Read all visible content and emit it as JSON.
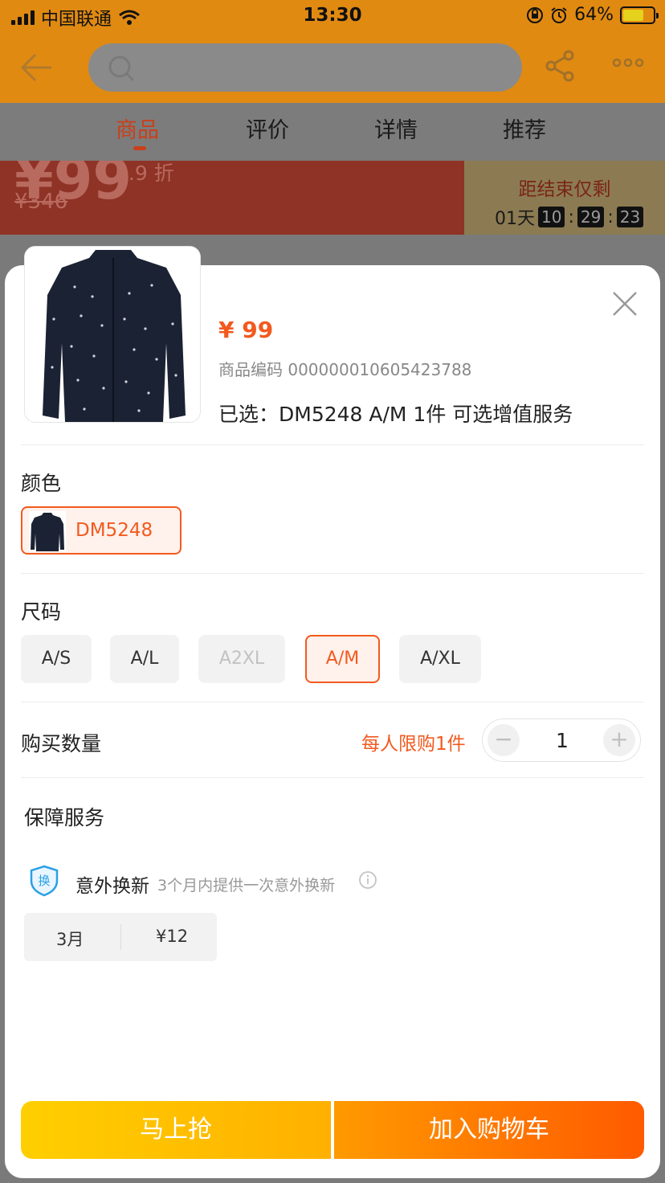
{
  "status_bar": {
    "carrier": "中国联通",
    "time": "13:30",
    "battery": "64%"
  },
  "nav": {
    "tabs": [
      {
        "label": "商品",
        "active": true
      },
      {
        "label": "评价",
        "active": false
      },
      {
        "label": "详情",
        "active": false
      },
      {
        "label": "推荐",
        "active": false
      }
    ]
  },
  "promo": {
    "price_partial": "¥99",
    "discount": "2.9 折",
    "original_price": "¥346",
    "countdown_label": "距结束仅剩",
    "days": "01天",
    "hours": "10",
    "minutes": "29",
    "seconds": "23"
  },
  "sheet": {
    "price": "¥ 99",
    "product_code": "商品编码 000000010605423788",
    "selected_summary": "已选：DM5248 A/M  1件  可选增值服务",
    "color_title": "颜色",
    "color_options": [
      {
        "label": "DM5248",
        "selected": true
      }
    ],
    "size_title": "尺码",
    "sizes": [
      {
        "label": "A/S",
        "state": "normal"
      },
      {
        "label": "A/L",
        "state": "normal"
      },
      {
        "label": "A2XL",
        "state": "disabled"
      },
      {
        "label": "A/M",
        "state": "selected"
      },
      {
        "label": "A/XL",
        "state": "normal"
      }
    ],
    "quantity_title": "购买数量",
    "quantity_limit": "每人限购1件",
    "quantity_value": "1",
    "service_title": "保障服务",
    "service": {
      "icon_text": "换",
      "name": "意外换新",
      "description": "3个月内提供一次意外换新",
      "plan_term": "3月",
      "plan_price": "¥12"
    },
    "buy_now": "马上抢",
    "add_to_cart": "加入购物车"
  },
  "colors": {
    "accent": "#f25a1f",
    "nav_bg": "#e08a12",
    "buy_now_gradient": [
      "#ffcf00",
      "#ffb000"
    ],
    "cart_gradient": [
      "#ff9a00",
      "#ff5a00"
    ]
  },
  "icons": [
    "back-arrow-icon",
    "search-icon",
    "share-icon",
    "more-icon",
    "close-icon",
    "shield-exchange-icon",
    "info-icon",
    "minus-icon",
    "plus-icon",
    "wifi-icon",
    "alarm-icon",
    "lock-rotation-icon"
  ]
}
